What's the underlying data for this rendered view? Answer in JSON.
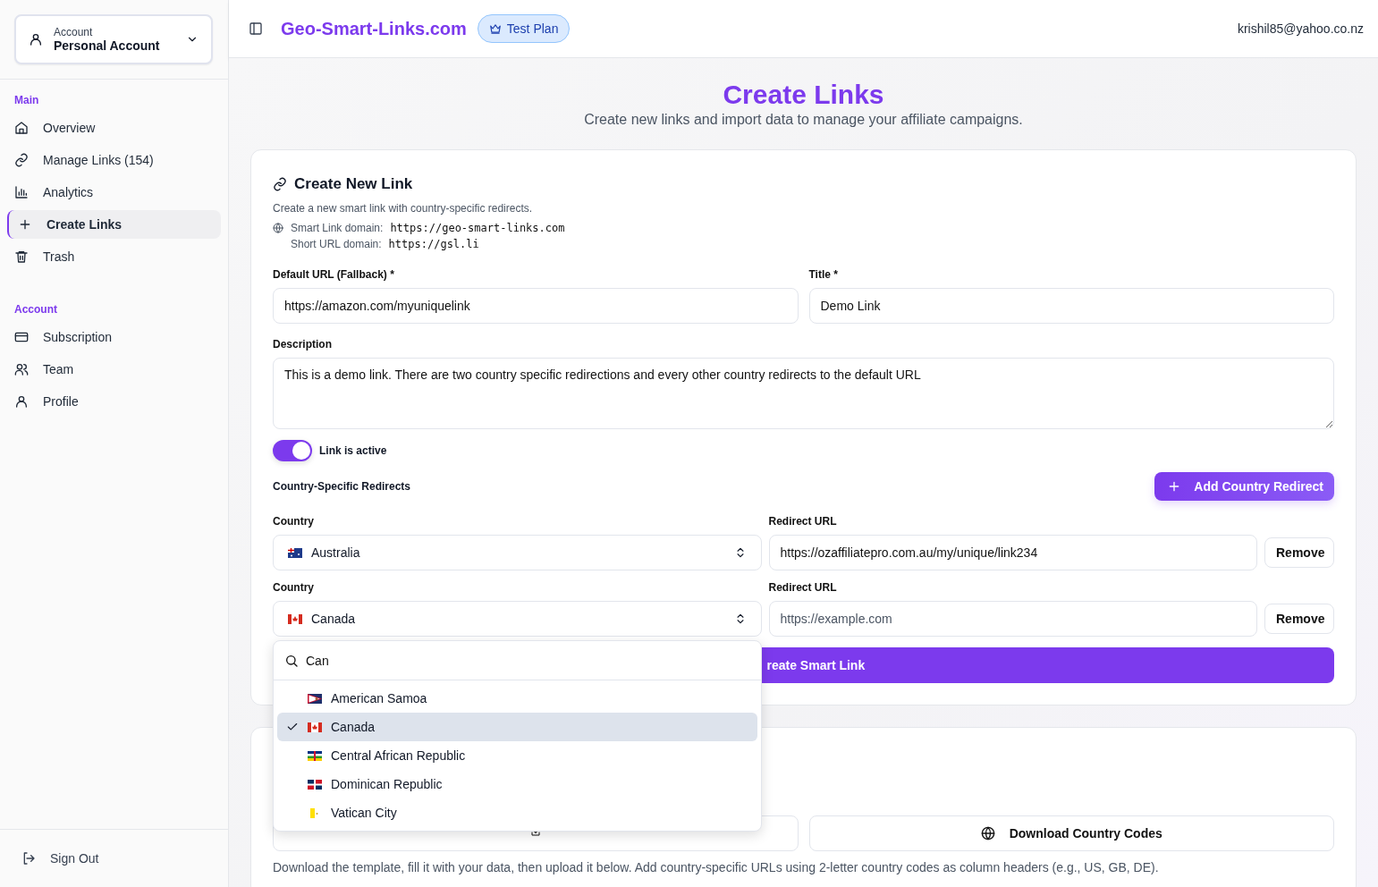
{
  "account_switcher": {
    "label": "Account",
    "value": "Personal Account"
  },
  "sidebar": {
    "sections": [
      {
        "title": "Main",
        "items": [
          {
            "label": "Overview",
            "selected": false
          },
          {
            "label": "Manage Links (154)",
            "selected": false
          },
          {
            "label": "Analytics",
            "selected": false
          },
          {
            "label": "Create Links",
            "selected": true
          },
          {
            "label": "Trash",
            "selected": false
          }
        ]
      },
      {
        "title": "Account",
        "items": [
          {
            "label": "Subscription",
            "selected": false
          },
          {
            "label": "Team",
            "selected": false
          },
          {
            "label": "Profile",
            "selected": false
          }
        ]
      }
    ],
    "sign_out": "Sign Out"
  },
  "header": {
    "brand": "Geo-Smart-Links.com",
    "plan_badge": "Test Plan",
    "user_email": "krishil85@yahoo.co.nz"
  },
  "page": {
    "title": "Create Links",
    "subtitle": "Create new links and import data to manage your affiliate campaigns."
  },
  "create_card": {
    "title": "Create New Link",
    "description": "Create a new smart link with country-specific redirects.",
    "smart_link_domain_label": "Smart Link domain:",
    "smart_link_domain": "https://geo-smart-links.com",
    "short_url_domain_label": "Short URL domain:",
    "short_url_domain": "https://gsl.li",
    "default_url": {
      "label": "Default URL (Fallback) *",
      "value": "https://amazon.com/myuniquelink"
    },
    "title_field": {
      "label": "Title *",
      "value": "Demo Link"
    },
    "description_field": {
      "label": "Description",
      "value": "This is a demo link. There are two country specific redirections and every other country redirects to the default URL"
    },
    "active_toggle": {
      "label": "Link is active",
      "on": true
    },
    "redirects_title": "Country-Specific Redirects",
    "add_button": "Add Country Redirect",
    "redirects": [
      {
        "country_label": "Country",
        "country": "Australia",
        "url_label": "Redirect URL",
        "url": "https://ozaffiliatepro.com.au/my/unique/link234",
        "remove": "Remove"
      },
      {
        "country_label": "Country",
        "country": "Canada",
        "url_label": "Redirect URL",
        "placeholder": "https://example.com",
        "remove": "Remove"
      }
    ],
    "submit_button": "reate Smart Link"
  },
  "country_dropdown": {
    "search_value": "Can",
    "options": [
      {
        "label": "American Samoa",
        "selected": false
      },
      {
        "label": "Canada",
        "selected": true
      },
      {
        "label": "Central African Republic",
        "selected": false
      },
      {
        "label": "Dominican Republic",
        "selected": false
      },
      {
        "label": "Vatican City",
        "selected": false
      }
    ]
  },
  "import_card": {
    "codes_button": "Download Country Codes",
    "help": "Download the template, fill it with your data, then upload it below. Add country-specific URLs using 2-letter country codes as column headers (e.g., US, GB, DE)."
  }
}
